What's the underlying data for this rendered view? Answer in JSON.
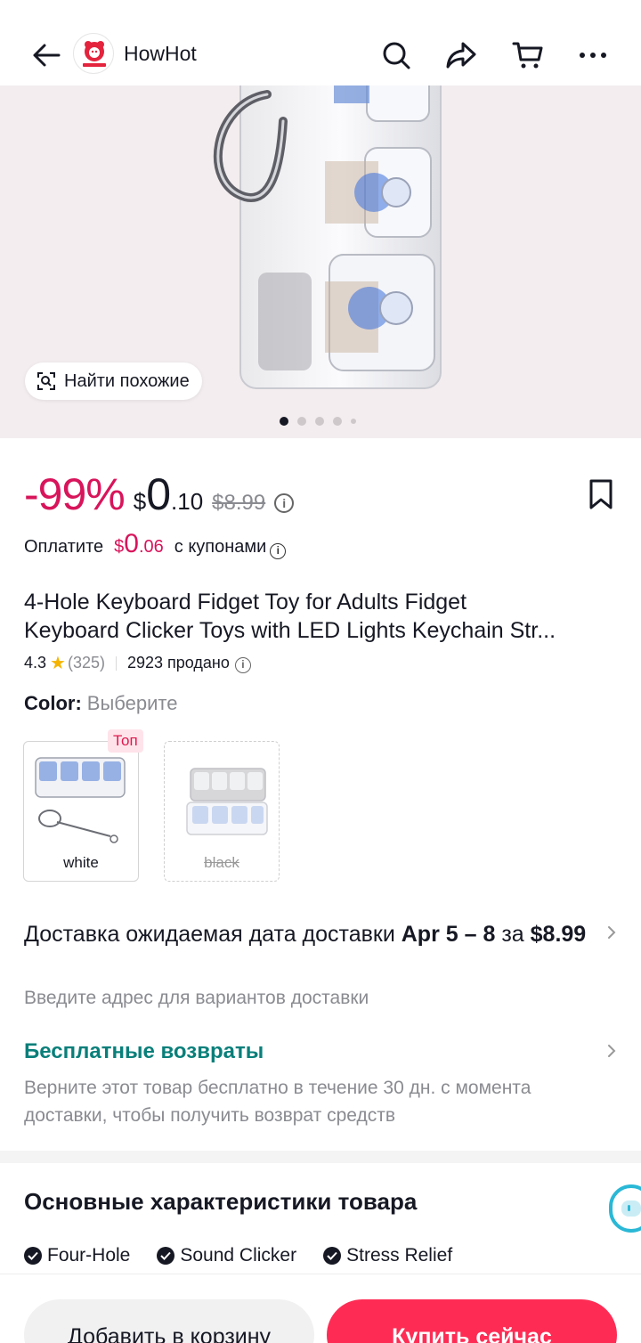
{
  "header": {
    "shop_name": "HowHot"
  },
  "gallery": {
    "find_similar_label": "Найти похожие"
  },
  "price": {
    "discount": "-99%",
    "currency": "$",
    "integer": "0",
    "decimal": ".10",
    "original": "$8.99"
  },
  "coupon": {
    "prefix": "Оплатите",
    "currency": "$",
    "integer": "0",
    "decimal": ".06",
    "suffix": "с купонами"
  },
  "product": {
    "title_line1": "4-Hole Keyboard Fidget Toy for Adults Fidget",
    "title_line2": "Keyboard Clicker Toys with LED Lights Keychain Str...",
    "rating": "4.3",
    "reviews": "(325)",
    "sold": "2923 продано"
  },
  "color": {
    "label": "Color:",
    "value": "Выберите",
    "top_badge": "Топ",
    "variants": [
      {
        "label": "white"
      },
      {
        "label": "black"
      }
    ]
  },
  "delivery": {
    "prefix": "Доставка ожидаемая дата доставки",
    "dates": "Apr 5 – 8",
    "middle": "за",
    "price": "$8.99",
    "subtitle": "Введите адрес для вариантов доставки"
  },
  "returns": {
    "title": "Бесплатные возвраты",
    "subtitle": "Верните этот товар бесплатно в течение 30 дн. с момента доставки, чтобы получить возврат средств"
  },
  "specs": {
    "title": "Основные характеристики товара",
    "chips": [
      "Four-Hole",
      "Sound Clicker",
      "Stress Relief"
    ]
  },
  "actions": {
    "add_to_cart": "Добавить в корзину",
    "buy_now": "Купить сейчас"
  },
  "colors": {
    "accent": "#fe2c55",
    "discount": "#d8145a",
    "returns": "#097f7a"
  }
}
